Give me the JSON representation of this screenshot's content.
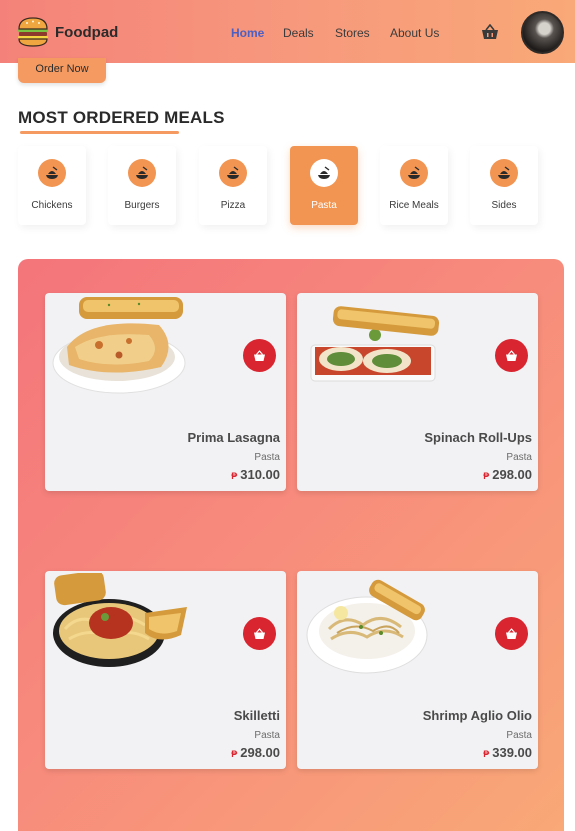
{
  "brand": {
    "name": "Foodpad",
    "icon": "burger-icon"
  },
  "nav": {
    "links": [
      {
        "label": "Home",
        "active": true
      },
      {
        "label": "Deals",
        "active": false
      },
      {
        "label": "Stores",
        "active": false
      },
      {
        "label": "About Us",
        "active": false
      }
    ],
    "basket_icon": "basket-icon",
    "avatar": "user-avatar"
  },
  "hero": {
    "order_button": "Order Now"
  },
  "section": {
    "title": "MOST ORDERED MEALS"
  },
  "categories": [
    {
      "label": "Chickens",
      "icon": "food-icon",
      "active": false
    },
    {
      "label": "Burgers",
      "icon": "food-icon",
      "active": false
    },
    {
      "label": "Pizza",
      "icon": "food-icon",
      "active": false
    },
    {
      "label": "Pasta",
      "icon": "food-icon",
      "active": true
    },
    {
      "label": "Rice Meals",
      "icon": "food-icon",
      "active": false
    },
    {
      "label": "Sides",
      "icon": "food-icon",
      "active": false
    }
  ],
  "meals": [
    {
      "name": "Prima Lasagna",
      "category": "Pasta",
      "currency": "₱",
      "price": "310.00"
    },
    {
      "name": "Spinach Roll-Ups",
      "category": "Pasta",
      "currency": "₱",
      "price": "298.00"
    },
    {
      "name": "Skilletti",
      "category": "Pasta",
      "currency": "₱",
      "price": "298.00"
    },
    {
      "name": "Shrimp Aglio Olio",
      "category": "Pasta",
      "currency": "₱",
      "price": "339.00"
    }
  ],
  "colors": {
    "accent": "#f29552",
    "nav_active": "#4d5fc1",
    "add_button": "#d9252f",
    "panel_start": "#f4757b",
    "panel_end": "#f9a877"
  }
}
